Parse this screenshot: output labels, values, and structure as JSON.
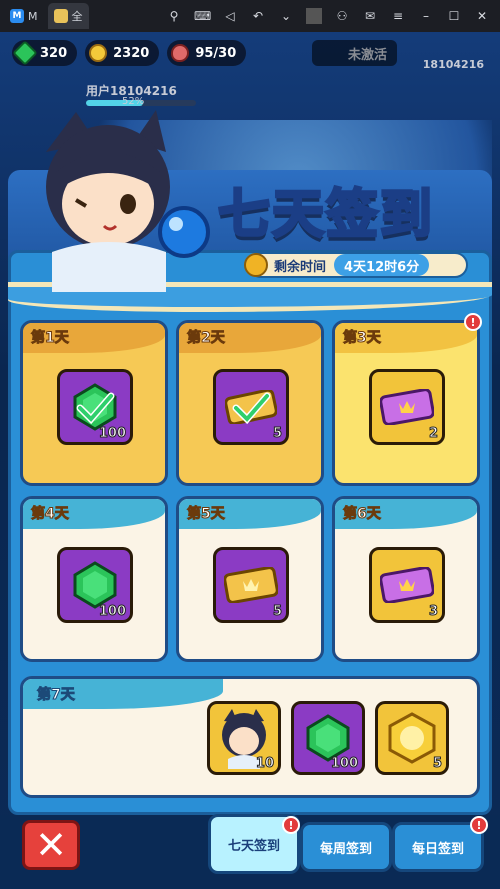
{
  "chrome": {
    "tab1": "M",
    "tab2": "全",
    "icons": [
      "pin-icon",
      "keyboard-icon",
      "volume-icon",
      "undo-icon",
      "chevron-down-icon",
      "account-icon",
      "mail-icon",
      "menu-icon",
      "minimize-icon",
      "maximize-icon",
      "close-icon"
    ]
  },
  "hud": {
    "gems": "320",
    "gold": "2320",
    "stamina": "95/30",
    "inactive_label": "未激活",
    "uid": "18104216",
    "user_name": "用户18104216",
    "exp_percent": "52%",
    "exp_fraction": 0.52
  },
  "event": {
    "title": "七天签到",
    "time_label": "剩余时间",
    "time_value": "4天12时6分"
  },
  "days": [
    {
      "label": "第1天",
      "qty": "100",
      "item": "gem",
      "state": "claimed"
    },
    {
      "label": "第2天",
      "qty": "5",
      "item": "gold-ticket",
      "state": "claimed"
    },
    {
      "label": "第3天",
      "qty": "2",
      "item": "purple-ticket",
      "state": "ready",
      "badge": "!"
    },
    {
      "label": "第4天",
      "qty": "100",
      "item": "gem",
      "state": "locked"
    },
    {
      "label": "第5天",
      "qty": "5",
      "item": "gold-ticket",
      "state": "locked"
    },
    {
      "label": "第6天",
      "qty": "3",
      "item": "purple-ticket",
      "state": "locked"
    }
  ],
  "day7": {
    "label": "第7天",
    "rewards": [
      {
        "item": "hero-portrait",
        "qty": "10"
      },
      {
        "item": "gem",
        "qty": "100"
      },
      {
        "item": "gold-coin",
        "qty": "5"
      }
    ]
  },
  "nav": {
    "close": "✕",
    "tabs": [
      "七天签到",
      "每周签到",
      "每日签到"
    ],
    "badge": "!"
  },
  "colors": {
    "panel": "#2a8fd6",
    "title_stroke": "#1b3e86",
    "claimed": "#f6c955",
    "ready": "#fbe36e",
    "locked": "#fbf4e6",
    "alert": "#e23b3b"
  }
}
